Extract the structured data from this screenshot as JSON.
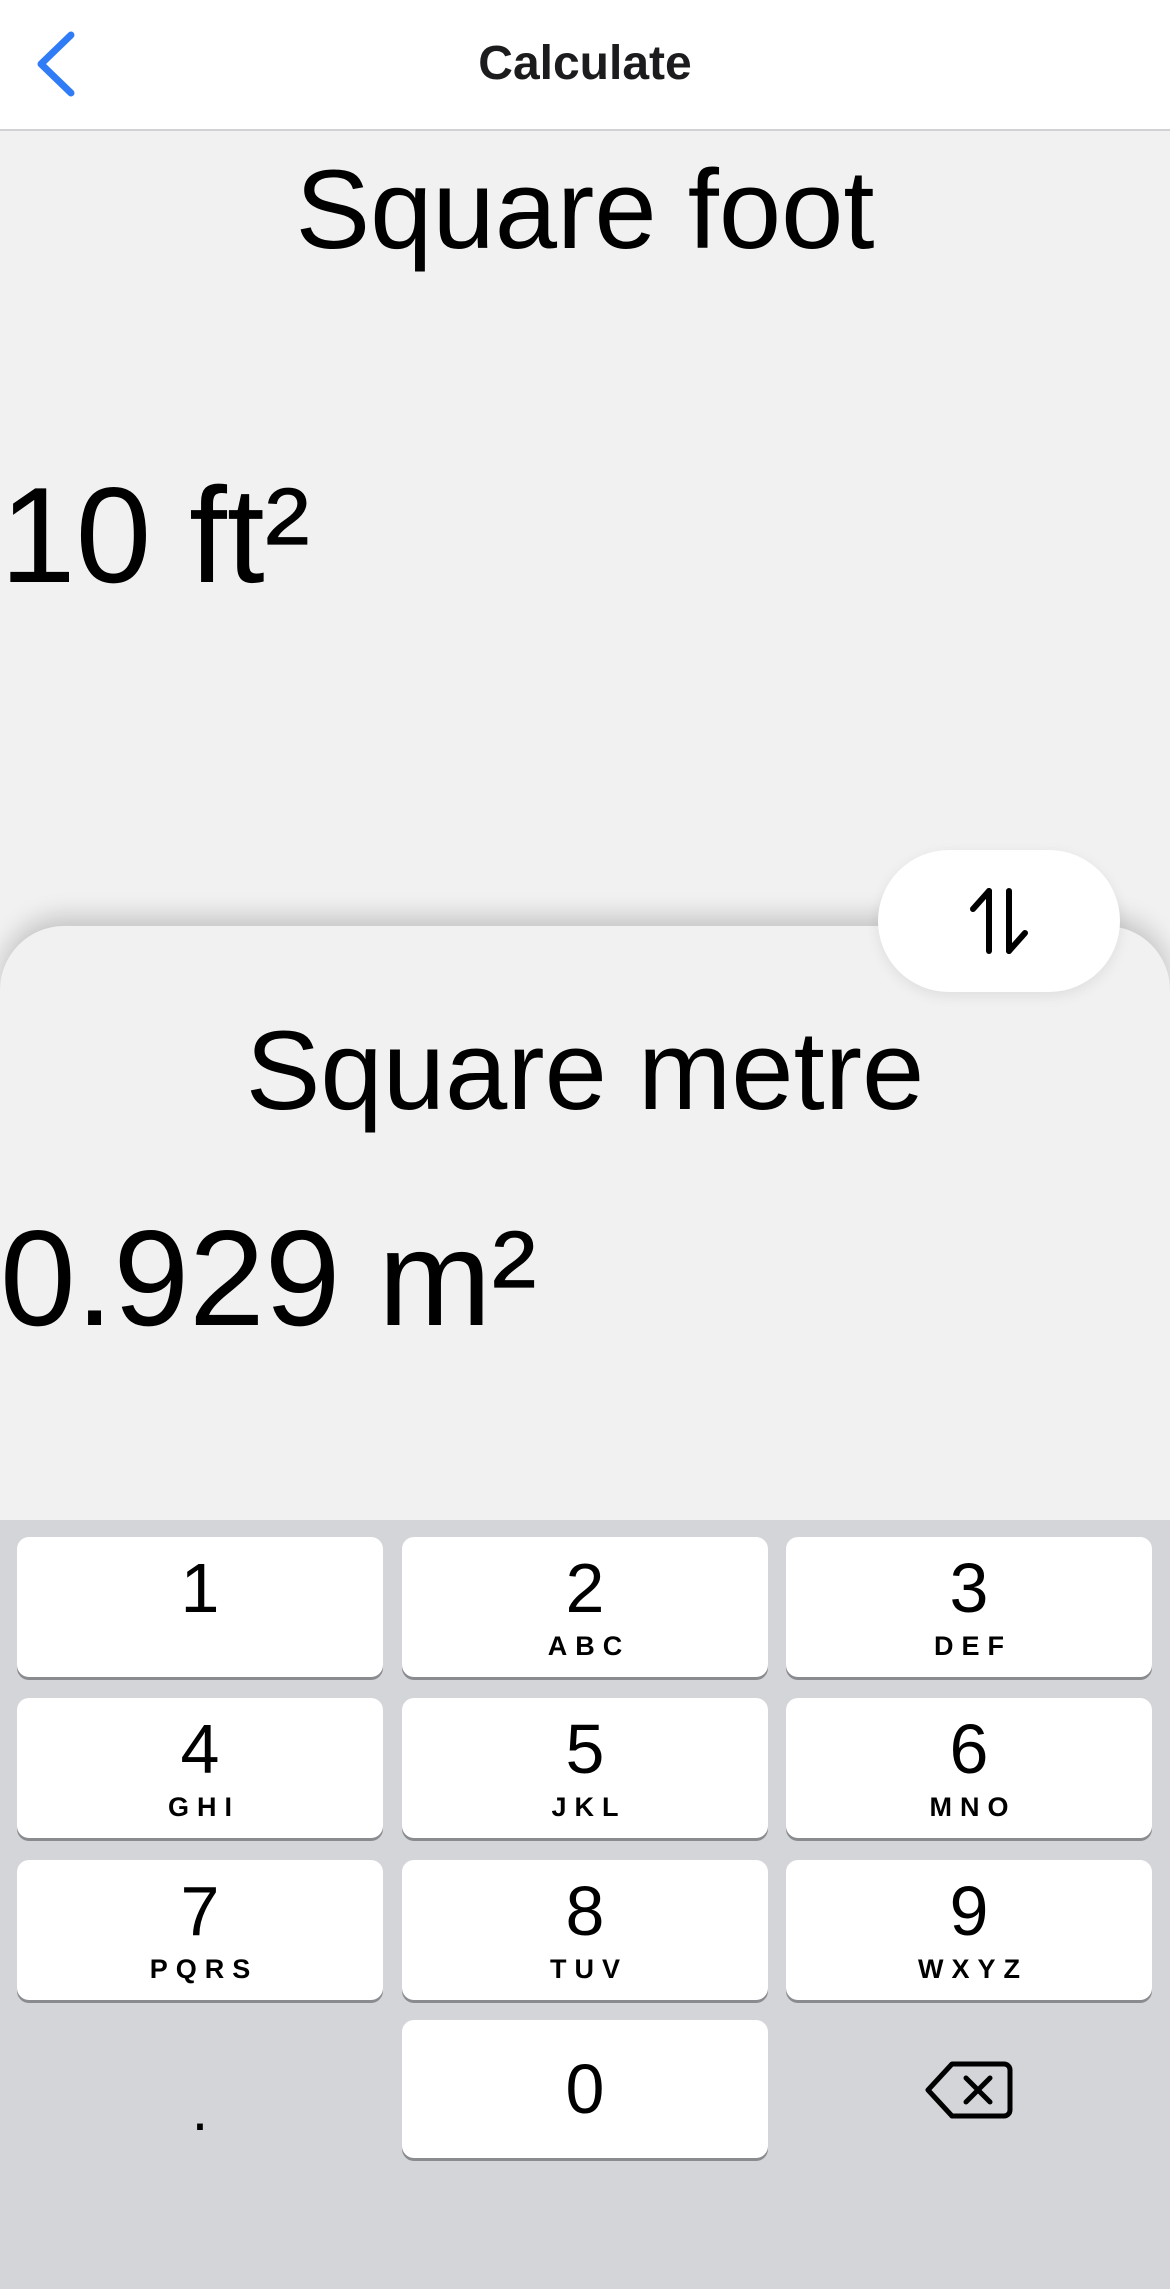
{
  "nav": {
    "title": "Calculate",
    "back_icon": "chevron-left-icon",
    "accent_color": "#2f7cf6"
  },
  "source": {
    "unit_name": "Square foot",
    "value": "10 ft²"
  },
  "target": {
    "unit_name": "Square metre",
    "value": "0.929 m²"
  },
  "swap": {
    "icon": "swap-vertical-arrows-icon"
  },
  "keypad": {
    "keys": [
      {
        "num": "1",
        "letters": ""
      },
      {
        "num": "2",
        "letters": "ABC"
      },
      {
        "num": "3",
        "letters": "DEF"
      },
      {
        "num": "4",
        "letters": "GHI"
      },
      {
        "num": "5",
        "letters": "JKL"
      },
      {
        "num": "6",
        "letters": "MNO"
      },
      {
        "num": "7",
        "letters": "PQRS"
      },
      {
        "num": "8",
        "letters": "TUV"
      },
      {
        "num": "9",
        "letters": "WXYZ"
      },
      {
        "num": "0",
        "letters": ""
      }
    ],
    "decimal": ".",
    "delete_icon": "backspace-icon"
  }
}
